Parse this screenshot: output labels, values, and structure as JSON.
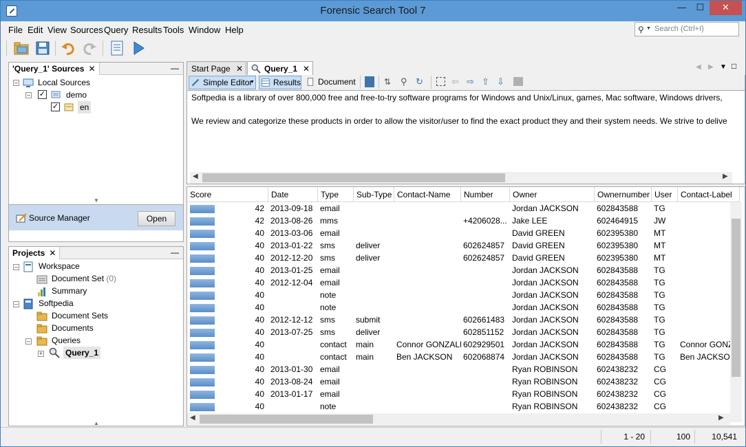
{
  "window": {
    "title": "Forensic Search Tool 7",
    "min_glyph": "—",
    "max_glyph": "☐",
    "close_glyph": "✕"
  },
  "menu": {
    "items": [
      "File",
      "Edit",
      "View",
      "Sources",
      "Query",
      "Results",
      "Tools",
      "Window",
      "Help"
    ]
  },
  "search": {
    "placeholder": "Search (Ctrl+I)"
  },
  "toolbar": {
    "icons": [
      "open-folder-icon",
      "save-icon",
      "undo-icon",
      "redo-icon",
      "document-list-icon",
      "run-icon"
    ]
  },
  "sources_panel": {
    "tab_label": "'Query_1' Sources",
    "close_glyph": "✕",
    "min_glyph": "—",
    "tree": {
      "root": "Local Sources",
      "child": "demo",
      "leaf": "en"
    },
    "source_manager_label": "Source Manager",
    "open_button": "Open"
  },
  "projects_panel": {
    "tab_label": "Projects",
    "close_glyph": "✕",
    "min_glyph": "—",
    "workspace": "Workspace",
    "document_set": "Document Set",
    "document_set_count": "(0)",
    "summary": "Summary",
    "softpedia": "Softpedia",
    "document_sets": "Document Sets",
    "documents": "Documents",
    "queries": "Queries",
    "query": "Query_1"
  },
  "doc_tabs": {
    "start_page": "Start Page",
    "query": "Query_1",
    "close_glyph": "✕"
  },
  "editor_toolbar": {
    "simple_editor": "Simple Editor",
    "results": "Results",
    "document": "Document"
  },
  "preview": {
    "line1": "Softpedia is a library of over 800,000 free and free-to-try software programs for Windows and Unix/Linux, games, Mac software, Windows drivers,",
    "line2": "We review and categorize these products in order to allow the visitor/user to find the exact product they and their system needs. We strive to delive"
  },
  "results": {
    "columns": [
      "Score",
      "Date",
      "Type",
      "Sub-Type",
      "Contact-Name",
      "Number",
      "Owner",
      "Ownernumber",
      "User",
      "Contact-Label"
    ],
    "rows": [
      {
        "score": "42",
        "date": "2013-09-18",
        "type": "email",
        "subtype": "",
        "contact_name": "",
        "number": "",
        "owner": "Jordan JACKSON",
        "ownernumber": "602843588",
        "user": "TG",
        "contact_label": ""
      },
      {
        "score": "42",
        "date": "2013-08-26",
        "type": "mms",
        "subtype": "",
        "contact_name": "",
        "number": "+4206028...",
        "owner": "Jake LEE",
        "ownernumber": "602464915",
        "user": "JW",
        "contact_label": ""
      },
      {
        "score": "40",
        "date": "2013-03-06",
        "type": "email",
        "subtype": "",
        "contact_name": "",
        "number": "",
        "owner": "David GREEN",
        "ownernumber": "602395380",
        "user": "MT",
        "contact_label": ""
      },
      {
        "score": "40",
        "date": "2013-01-22",
        "type": "sms",
        "subtype": "deliver",
        "contact_name": "",
        "number": "602624857",
        "owner": "David GREEN",
        "ownernumber": "602395380",
        "user": "MT",
        "contact_label": ""
      },
      {
        "score": "40",
        "date": "2012-12-20",
        "type": "sms",
        "subtype": "deliver",
        "contact_name": "",
        "number": "602624857",
        "owner": "David GREEN",
        "ownernumber": "602395380",
        "user": "MT",
        "contact_label": ""
      },
      {
        "score": "40",
        "date": "2013-01-25",
        "type": "email",
        "subtype": "",
        "contact_name": "",
        "number": "",
        "owner": "Jordan JACKSON",
        "ownernumber": "602843588",
        "user": "TG",
        "contact_label": ""
      },
      {
        "score": "40",
        "date": "2012-12-04",
        "type": "email",
        "subtype": "",
        "contact_name": "",
        "number": "",
        "owner": "Jordan JACKSON",
        "ownernumber": "602843588",
        "user": "TG",
        "contact_label": ""
      },
      {
        "score": "40",
        "date": "",
        "type": "note",
        "subtype": "",
        "contact_name": "",
        "number": "",
        "owner": "Jordan JACKSON",
        "ownernumber": "602843588",
        "user": "TG",
        "contact_label": ""
      },
      {
        "score": "40",
        "date": "",
        "type": "note",
        "subtype": "",
        "contact_name": "",
        "number": "",
        "owner": "Jordan JACKSON",
        "ownernumber": "602843588",
        "user": "TG",
        "contact_label": ""
      },
      {
        "score": "40",
        "date": "2012-12-12",
        "type": "sms",
        "subtype": "submit",
        "contact_name": "",
        "number": "602661483",
        "owner": "Jordan JACKSON",
        "ownernumber": "602843588",
        "user": "TG",
        "contact_label": ""
      },
      {
        "score": "40",
        "date": "2013-07-25",
        "type": "sms",
        "subtype": "deliver",
        "contact_name": "",
        "number": "602851152",
        "owner": "Jordan JACKSON",
        "ownernumber": "602843588",
        "user": "TG",
        "contact_label": ""
      },
      {
        "score": "40",
        "date": "",
        "type": "contact",
        "subtype": "main",
        "contact_name": "Connor GONZALEZ",
        "number": "602929501",
        "owner": "Jordan JACKSON",
        "ownernumber": "602843588",
        "user": "TG",
        "contact_label": "Connor GONZA"
      },
      {
        "score": "40",
        "date": "",
        "type": "contact",
        "subtype": "main",
        "contact_name": "Ben JACKSON",
        "number": "602068874",
        "owner": "Jordan JACKSON",
        "ownernumber": "602843588",
        "user": "TG",
        "contact_label": "Ben JACKSON"
      },
      {
        "score": "40",
        "date": "2013-01-30",
        "type": "email",
        "subtype": "",
        "contact_name": "",
        "number": "",
        "owner": "Ryan ROBINSON",
        "ownernumber": "602438232",
        "user": "CG",
        "contact_label": ""
      },
      {
        "score": "40",
        "date": "2013-08-24",
        "type": "email",
        "subtype": "",
        "contact_name": "",
        "number": "",
        "owner": "Ryan ROBINSON",
        "ownernumber": "602438232",
        "user": "CG",
        "contact_label": ""
      },
      {
        "score": "40",
        "date": "2013-01-17",
        "type": "email",
        "subtype": "",
        "contact_name": "",
        "number": "",
        "owner": "Ryan ROBINSON",
        "ownernumber": "602438232",
        "user": "CG",
        "contact_label": ""
      },
      {
        "score": "40",
        "date": "",
        "type": "note",
        "subtype": "",
        "contact_name": "",
        "number": "",
        "owner": "Ryan ROBINSON",
        "ownernumber": "602438232",
        "user": "CG",
        "contact_label": ""
      }
    ]
  },
  "status": {
    "range": "1 - 20",
    "zoom": "100",
    "total": "10,541"
  },
  "colors": {
    "title_bar": "#5c9ad6",
    "close_button": "#c75050",
    "selection": "#c9dff5",
    "score_bar": "#5b8ec9"
  }
}
